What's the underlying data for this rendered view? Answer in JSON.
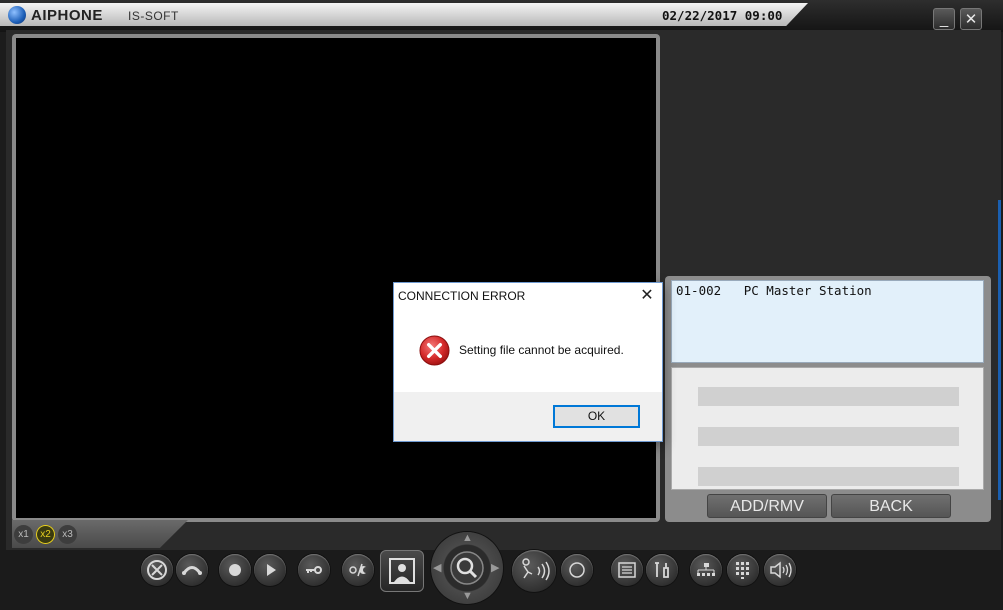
{
  "title_bar": {
    "brand": "AIPHONE",
    "product": "IS-SOFT",
    "datetime": "02/22/2017  09:00",
    "minimize_label": "_",
    "close_label": "✕"
  },
  "zoom": {
    "options": [
      "x1",
      "x2",
      "x3"
    ],
    "selected": "x2"
  },
  "station_list": {
    "selected_entry": "01-002   PC Master Station"
  },
  "panel_buttons": {
    "add_remove": "ADD/RMV",
    "back": "BACK"
  },
  "dialog": {
    "title": "CONNECTION ERROR",
    "message": "Setting file cannot be acquired.",
    "ok_label": "OK",
    "close_label": "✕",
    "icon": "error-icon"
  },
  "toolbar_icons": [
    "end-call-icon",
    "call-icon",
    "record-icon",
    "play-icon",
    "door-release-icon",
    "day-night-icon",
    "camera-view-icon",
    "zoom-icon",
    "talk-icon",
    "option-icon",
    "list-icon",
    "settings-icon",
    "network-icon",
    "keypad-icon",
    "volume-icon"
  ],
  "colors": {
    "dialog_border": "#6f9ad1",
    "ok_focus": "#0078d7",
    "station_highlight": "#e2f0fa",
    "error_red": "#d42a2a",
    "zoom_active": "#e8d020"
  }
}
